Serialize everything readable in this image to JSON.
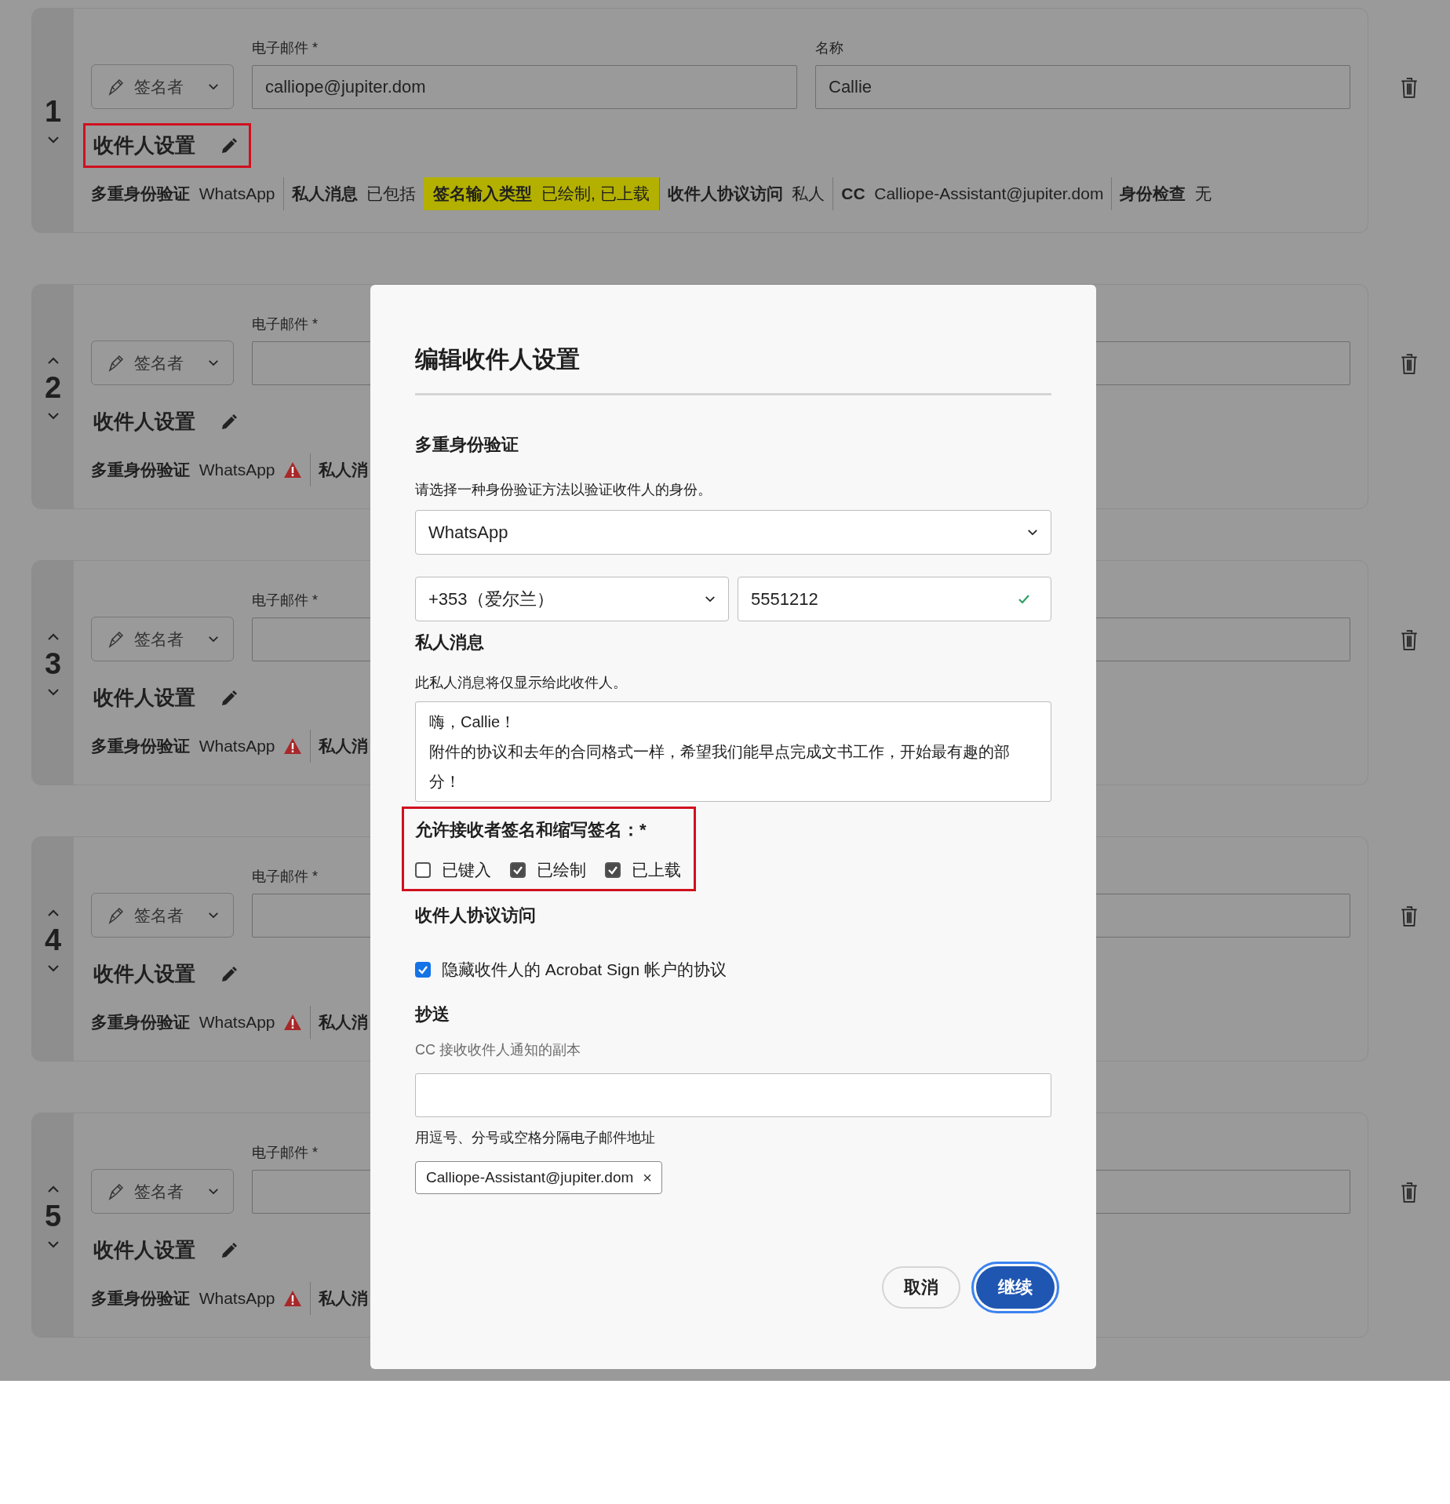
{
  "recipients": [
    {
      "number": "1",
      "move_up_shown": false,
      "role": "签名者",
      "email_label": "电子邮件 *",
      "email": "calliope@jupiter.dom",
      "name_label": "名称",
      "name": "Callie",
      "settings_label": "收件人设置",
      "settings_outlined": true,
      "summary": [
        {
          "label": "多重身份验证",
          "value": "WhatsApp",
          "warning": false,
          "highlighted": false
        },
        {
          "label": "私人消息",
          "value": "已包括",
          "warning": false,
          "highlighted": false
        },
        {
          "label": "签名输入类型",
          "value": "已绘制, 已上载",
          "warning": false,
          "highlighted": true
        },
        {
          "label": "收件人协议访问",
          "value": "私人",
          "warning": false,
          "highlighted": false
        },
        {
          "label": "CC",
          "value": "Calliope-Assistant@jupiter.dom",
          "warning": false,
          "highlighted": false
        },
        {
          "label": "身份检查",
          "value": "无",
          "warning": false,
          "highlighted": false
        }
      ]
    },
    {
      "number": "2",
      "move_up_shown": true,
      "role": "签名者",
      "email_label": "电子邮件 *",
      "settings_label": "收件人设置",
      "settings_outlined": false,
      "summary": [
        {
          "label": "多重身份验证",
          "value": "WhatsApp",
          "warning": true,
          "highlighted": false
        },
        {
          "label": "私人消",
          "warning": false,
          "highlighted": false
        }
      ]
    },
    {
      "number": "3",
      "move_up_shown": true,
      "role": "签名者",
      "email_label": "电子邮件 *",
      "settings_label": "收件人设置",
      "settings_outlined": false,
      "summary": [
        {
          "label": "多重身份验证",
          "value": "WhatsApp",
          "warning": true,
          "highlighted": false
        },
        {
          "label": "私人消",
          "warning": false,
          "highlighted": false
        }
      ]
    },
    {
      "number": "4",
      "move_up_shown": true,
      "role": "签名者",
      "email_label": "电子邮件 *",
      "settings_label": "收件人设置",
      "settings_outlined": false,
      "summary": [
        {
          "label": "多重身份验证",
          "value": "WhatsApp",
          "warning": true,
          "highlighted": false
        },
        {
          "label": "私人消",
          "warning": false,
          "highlighted": false
        }
      ]
    },
    {
      "number": "5",
      "move_up_shown": true,
      "role": "签名者",
      "email_label": "电子邮件 *",
      "settings_label": "收件人设置",
      "settings_outlined": false,
      "summary": [
        {
          "label": "多重身份验证",
          "value": "WhatsApp",
          "warning": true,
          "highlighted": false
        },
        {
          "label": "私人消",
          "warning": false,
          "highlighted": false
        }
      ]
    }
  ],
  "dialog": {
    "title": "编辑收件人设置",
    "auth": {
      "heading": "多重身份验证",
      "description": "请选择一种身份验证方法以验证收件人的身份。",
      "method": "WhatsApp",
      "country": "+353（爱尔兰）",
      "phone": "5551212",
      "phone_valid": true
    },
    "message": {
      "heading": "私人消息",
      "description": "此私人消息将仅显示给此收件人。",
      "lines": [
        "嗨，Callie！",
        "附件的协议和去年的合同格式一样，希望我们能早点完成文书工作，开始最有趣的部分！"
      ]
    },
    "signature_types": {
      "label": "允许接收者签名和缩写签名：*",
      "outlined": true,
      "options": [
        {
          "label": "已键入",
          "checked": false
        },
        {
          "label": "已绘制",
          "checked": true
        },
        {
          "label": "已上载",
          "checked": true
        }
      ]
    },
    "access": {
      "heading": "收件人协议访问",
      "option": {
        "label": "隐藏收件人的 Acrobat Sign 帐户的协议",
        "checked": true
      }
    },
    "cc": {
      "heading": "抄送",
      "description": "CC 接收收件人通知的副本",
      "hint": "用逗号、分号或空格分隔电子邮件地址",
      "chips": [
        {
          "label": "Calliope-Assistant@jupiter.dom",
          "remove": "×"
        }
      ]
    },
    "buttons": [
      {
        "label": "取消",
        "kind": "secondary",
        "focused": false
      },
      {
        "label": "继续",
        "kind": "primary",
        "focused": true
      }
    ]
  }
}
